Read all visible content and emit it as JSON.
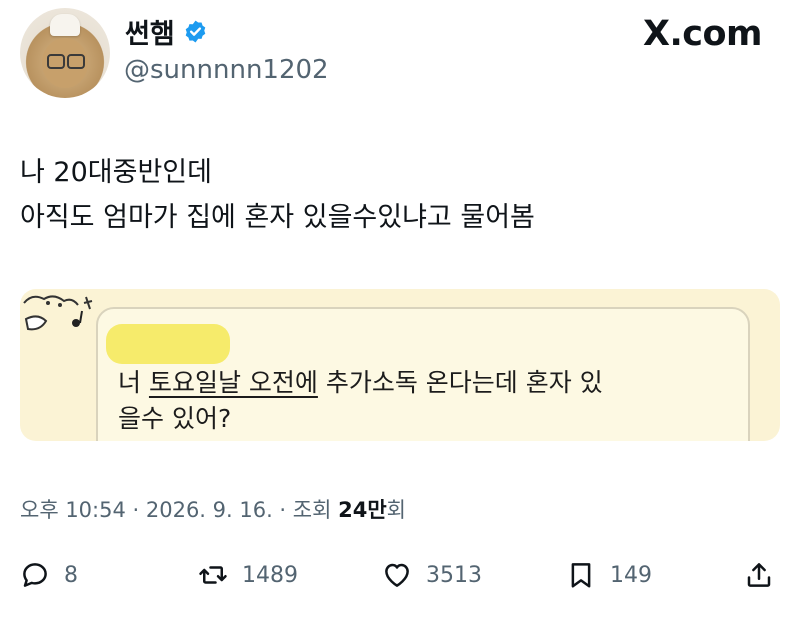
{
  "user": {
    "name": "썬햄",
    "handle": "@sunnnnn1202"
  },
  "brand": "X.com",
  "tweet": {
    "lines": [
      "나 20대중반인데",
      "아직도 엄마가 집에 혼자 있을수있냐고 물어봄"
    ]
  },
  "media": {
    "message_line1_parts": [
      "너 ",
      "토요일날 오전에",
      " 추가소독 온다는데 혼자 있"
    ],
    "message_line2": "을수 있어?"
  },
  "meta": {
    "time_date": "오후 10:54 · 2026. 9. 16. · 조회 ",
    "views": "24만",
    "views_suffix": "회"
  },
  "stats": {
    "replies": "8",
    "reposts": "1489",
    "likes": "3513",
    "bookmarks": "149"
  },
  "icons": {
    "verified": "verified-badge-icon",
    "reply": "reply-icon",
    "repost": "repost-icon",
    "like": "heart-icon",
    "bookmark": "bookmark-icon",
    "share": "share-icon"
  },
  "colors": {
    "verified": "#1d9bf0",
    "text": "#0f1419",
    "secondary": "#536471",
    "media_bg": "#fbf3d5",
    "highlight": "#f6eb6b"
  }
}
